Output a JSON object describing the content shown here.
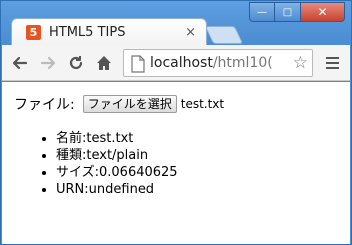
{
  "browser": {
    "tab_title": "HTML5 TIPS",
    "tab_close": "×",
    "url_host": "localhost",
    "url_path": "/html10(",
    "window_buttons": {
      "minimize": "—",
      "maximize": "□",
      "close": "✕"
    }
  },
  "page": {
    "file_label": "ファイル:",
    "file_button_label": "ファイルを選択",
    "file_name": "test.txt",
    "info": [
      {
        "label": "名前:",
        "value": "test.txt"
      },
      {
        "label": "種類:",
        "value": "text/plain"
      },
      {
        "label": "サイズ:",
        "value": "0.06640625"
      },
      {
        "label": "URN:",
        "value": "undefined"
      }
    ]
  },
  "colors": {
    "title_bar": "#4b8cd2",
    "favicon": "#e8541f",
    "toolbar": "#f4f4f4"
  }
}
